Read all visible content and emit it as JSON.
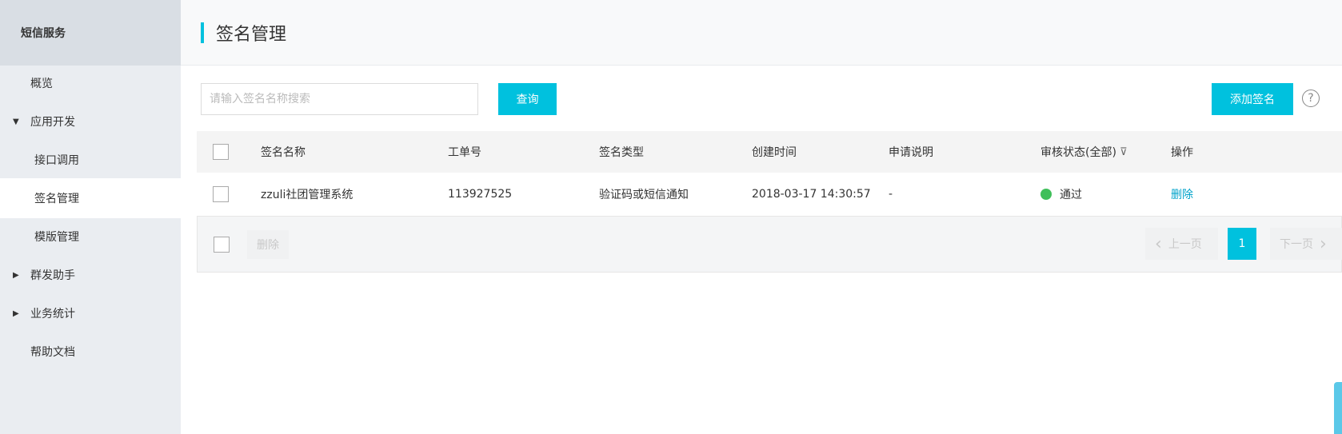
{
  "sidebar": {
    "title": "短信服务",
    "items": [
      {
        "label": "概览"
      },
      {
        "label": "应用开发",
        "caret": "▼"
      },
      {
        "label": "接口调用"
      },
      {
        "label": "签名管理"
      },
      {
        "label": "模版管理"
      },
      {
        "label": "群发助手",
        "caret": "▶"
      },
      {
        "label": "业务统计",
        "caret": "▶"
      },
      {
        "label": "帮助文档"
      }
    ]
  },
  "page": {
    "title": "签名管理"
  },
  "toolbar": {
    "search_placeholder": "请输入签名名称搜索",
    "query_label": "查询",
    "add_label": "添加签名",
    "help_glyph": "?"
  },
  "table": {
    "columns": [
      "签名名称",
      "工单号",
      "签名类型",
      "创建时间",
      "申请说明",
      "审核状态(全部)",
      "操作"
    ],
    "filter_glyph": "⊽",
    "rows": [
      {
        "name": "zzuli社团管理系统",
        "ticket": "113927525",
        "type": "验证码或短信通知",
        "created": "2018-03-17 14:30:57",
        "note": "-",
        "status": "通过",
        "status_color": "#3fbf5a",
        "action": "删除"
      }
    ]
  },
  "footer": {
    "batch_delete_label": "删除",
    "prev_label": "上一页",
    "next_label": "下一页",
    "current_page": "1",
    "prev_chevron": "‹",
    "next_chevron": "›"
  },
  "colors": {
    "accent": "#00c1de",
    "link": "#00a2ca",
    "sidebar_bg": "#eaedf1"
  }
}
